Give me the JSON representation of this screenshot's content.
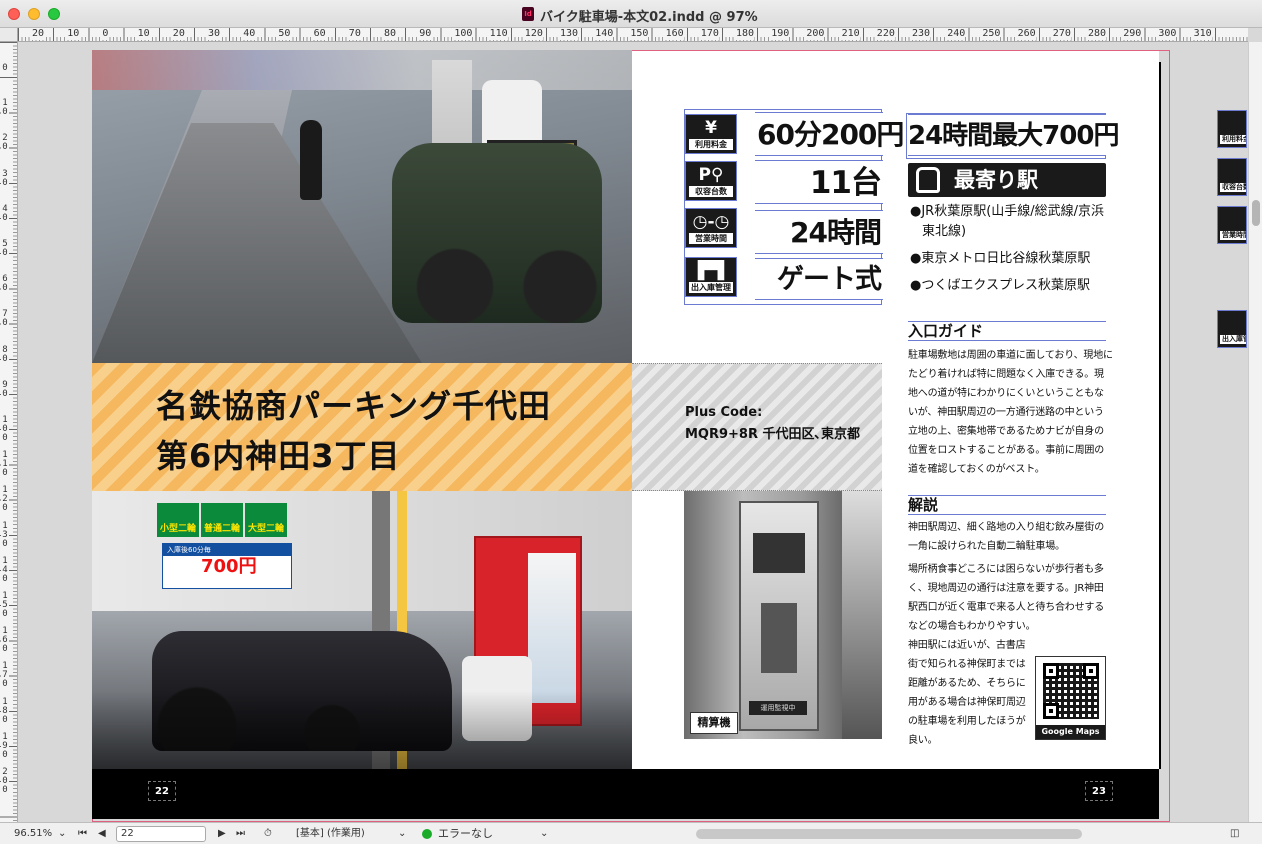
{
  "window": {
    "title": "バイク駐車場-本文02.indd @ 97%",
    "doc_icon": "Id"
  },
  "ruler": {
    "top_labels": [
      "20",
      "10",
      "0",
      "10",
      "20",
      "30",
      "40",
      "50",
      "60",
      "70",
      "80",
      "90",
      "100",
      "110",
      "120",
      "130",
      "140",
      "150",
      "160",
      "170",
      "180",
      "190",
      "200",
      "210",
      "220",
      "230",
      "240",
      "250",
      "260",
      "270",
      "280",
      "290",
      "300",
      "310"
    ],
    "left_labels": [
      "0",
      "10",
      "20",
      "30",
      "40",
      "50",
      "60",
      "70",
      "80",
      "90",
      "100",
      "110",
      "120",
      "130",
      "140",
      "150",
      "160",
      "170",
      "180",
      "190",
      "200"
    ]
  },
  "page": {
    "title_line1": "名鉄協商パーキング千代田",
    "title_line2": "第6内神田3丁目",
    "plus_code_label": "Plus Code:",
    "plus_code_value": "MQR9+8R 千代田区､東京都",
    "photo_caption": "精算機",
    "lot_signs": [
      "小型二輪",
      "普通二輪",
      "大型二輪"
    ],
    "lot_price_top": "入庫後60分毎",
    "lot_price": "700円",
    "machine_stamp": "運用監視中",
    "rows": [
      {
        "icon": "¥",
        "icon_name": "yen-icon",
        "label": "利用料金",
        "value": "60分200円"
      },
      {
        "icon": "P⚲",
        "icon_name": "parking-bike-icon",
        "label": "収容台数",
        "value": "11台"
      },
      {
        "icon": "◷-◷",
        "icon_name": "clock-icon",
        "label": "営業時間",
        "value": "24時間"
      },
      {
        "icon": "▛▜",
        "icon_name": "gate-icon",
        "label": "出入庫管理",
        "value": "ゲート式"
      }
    ],
    "max_rate": "24時間最大700円",
    "station_header": "最寄り駅",
    "stations": [
      "●JR秋葉原駅(山手線/総武線/京浜東北線)",
      "●東京メトロ日比谷線秋葉原駅",
      "●つくばエクスプレス秋葉原駅"
    ],
    "guide_heading": "入口ガイド",
    "guide_text": "駐車場敷地は周囲の車道に面しており、現地にたどり着ければ特に問題なく入庫できる。現地への道が特にわかりにくいということもないが、神田駅周辺の一方通行迷路の中という立地の上、密集地帯であるためナビが自身の位置をロストすることがある。事前に周囲の道を確認しておくのがベスト。",
    "explain_heading": "解説",
    "explain_p1": "神田駅周辺、細く路地の入り組む飲み屋街の一角に設けられた自動二輪駐車場。",
    "explain_p2": "場所柄食事どころには困らないが歩行者も多く、現地周辺の通行は注意を要する。JR神田駅西口が近く電車で来る人と待ち合わせするなどの場合もわかりやすい。",
    "explain_p3": "神田駅には近いが、古書店街で知られる神保町までは距離があるため、そちらに用がある場合は神保町周辺の駐車場を利用したほうが良い。",
    "qr_label": "Google Maps",
    "folio_left": "22",
    "folio_right": "23"
  },
  "pasteboard": {
    "thumbs": [
      "利用料金",
      "収容台数",
      "営業時間",
      "出入庫管理"
    ]
  },
  "status": {
    "zoom": "96.51%",
    "page_field": "22",
    "style": "[基本] (作業用)",
    "preflight": "エラーなし"
  }
}
